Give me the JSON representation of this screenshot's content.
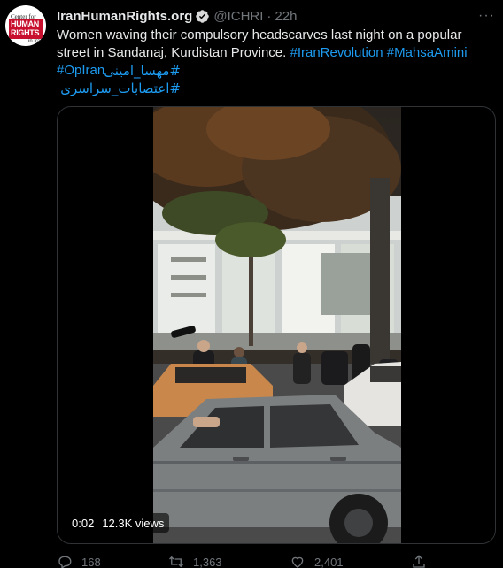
{
  "tweet": {
    "author_name": "IranHumanRights.org",
    "handle": "@ICHRI",
    "separator": "·",
    "time": "22h",
    "more_glyph": "···",
    "text_main": "Women waving their compulsory headscarves last night on a popular street in Sandanaj, Kurdistan Province. ",
    "hashtags_inline": [
      "#IranRevolution",
      "#MahsaAmini",
      "#OpIran"
    ],
    "hashtag_rtl_1": "#مهسا_امینی",
    "hashtag_rtl_2": "#اعتصابات_سراسری"
  },
  "avatar": {
    "line1": "Center for",
    "line2": "HUMAN",
    "line3": "RIGHTS",
    "line4": "in Iran"
  },
  "video": {
    "duration": "0:02",
    "views": "12.3K views"
  },
  "actions": {
    "reply_count": "168",
    "retweet_count": "1,363",
    "like_count": "2,401"
  },
  "colors": {
    "background": "#000000",
    "text": "#e7e9ea",
    "muted": "#71767b",
    "link": "#1d9bf0",
    "verified_badge": "#d9d9d9"
  },
  "icons": [
    "verified-badge-icon",
    "more-icon",
    "reply-icon",
    "retweet-icon",
    "like-icon",
    "share-icon"
  ]
}
